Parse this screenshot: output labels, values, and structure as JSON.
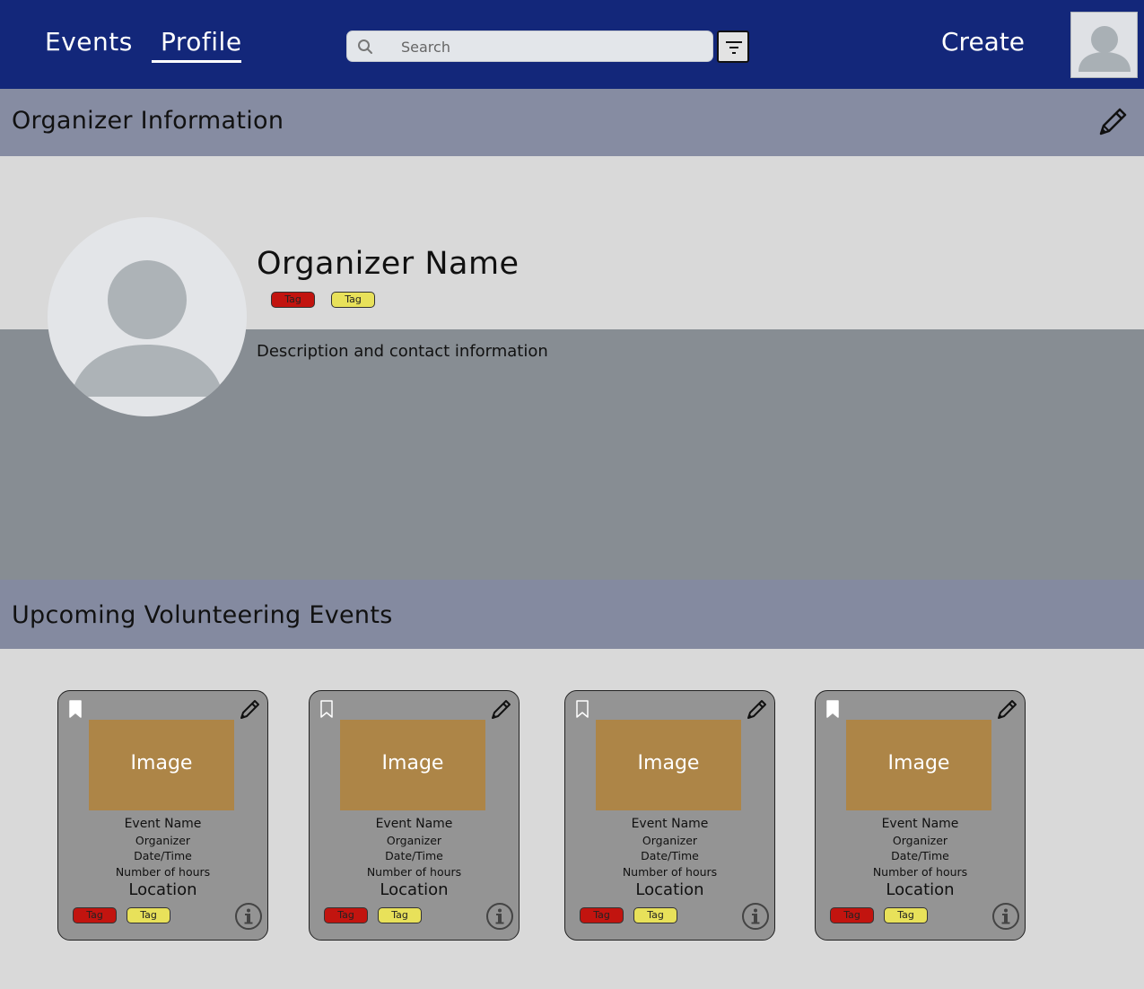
{
  "header": {
    "nav": {
      "events_label": "Events",
      "profile_label": "Profile"
    },
    "search": {
      "placeholder": "Search"
    },
    "create_label": "Create",
    "colors": {
      "background": "#13277a",
      "text": "#ffffff"
    }
  },
  "organizer_section": {
    "title": "Organizer Information",
    "name": "Organizer Name",
    "tags": [
      {
        "label": "Tag",
        "color": "#c2140f"
      },
      {
        "label": "Tag",
        "color": "#e8e15a"
      }
    ],
    "description": "Description and contact information"
  },
  "events_section": {
    "title": "Upcoming Volunteering Events",
    "cards": [
      {
        "bookmarked": true,
        "image_label": "Image",
        "event_name": "Event Name",
        "organizer": "Organizer",
        "datetime": "Date/Time",
        "hours": "Number of hours",
        "location": "Location",
        "tags": [
          "Tag",
          "Tag"
        ]
      },
      {
        "bookmarked": false,
        "image_label": "Image",
        "event_name": "Event Name",
        "organizer": "Organizer",
        "datetime": "Date/Time",
        "hours": "Number of hours",
        "location": "Location",
        "tags": [
          "Tag",
          "Tag"
        ]
      },
      {
        "bookmarked": false,
        "image_label": "Image",
        "event_name": "Event Name",
        "organizer": "Organizer",
        "datetime": "Date/Time",
        "hours": "Number of hours",
        "location": "Location",
        "tags": [
          "Tag",
          "Tag"
        ]
      },
      {
        "bookmarked": true,
        "image_label": "Image",
        "event_name": "Event Name",
        "organizer": "Organizer",
        "datetime": "Date/Time",
        "hours": "Number of hours",
        "location": "Location",
        "tags": [
          "Tag",
          "Tag"
        ]
      }
    ]
  },
  "icons": {
    "search": "search-icon",
    "filter": "filter-icon",
    "avatar": "avatar-icon",
    "edit": "pencil-icon",
    "bookmark": "bookmark-icon",
    "info": "info-icon"
  }
}
